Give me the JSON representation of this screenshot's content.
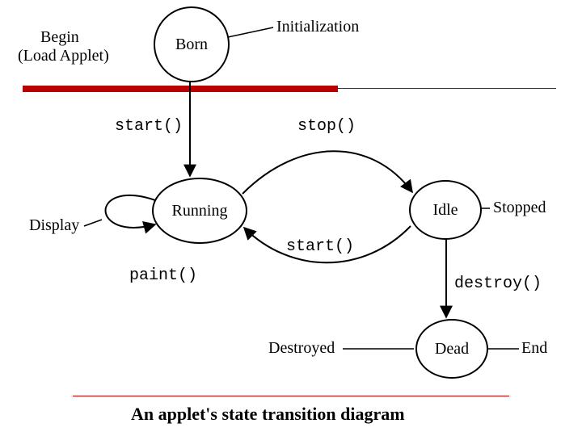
{
  "states": {
    "born": "Born",
    "running": "Running",
    "idle": "Idle",
    "dead": "Dead"
  },
  "labels": {
    "begin_line1": "Begin",
    "begin_line2": "(Load Applet)",
    "initialization": "Initialization",
    "display": "Display",
    "stopped": "Stopped",
    "destroyed": "Destroyed",
    "end": "End"
  },
  "transitions": {
    "start_down": "start()",
    "stop": "stop()",
    "start_back": "start()",
    "paint": "paint()",
    "destroy": "destroy()"
  },
  "caption": "An applet's state transition diagram"
}
